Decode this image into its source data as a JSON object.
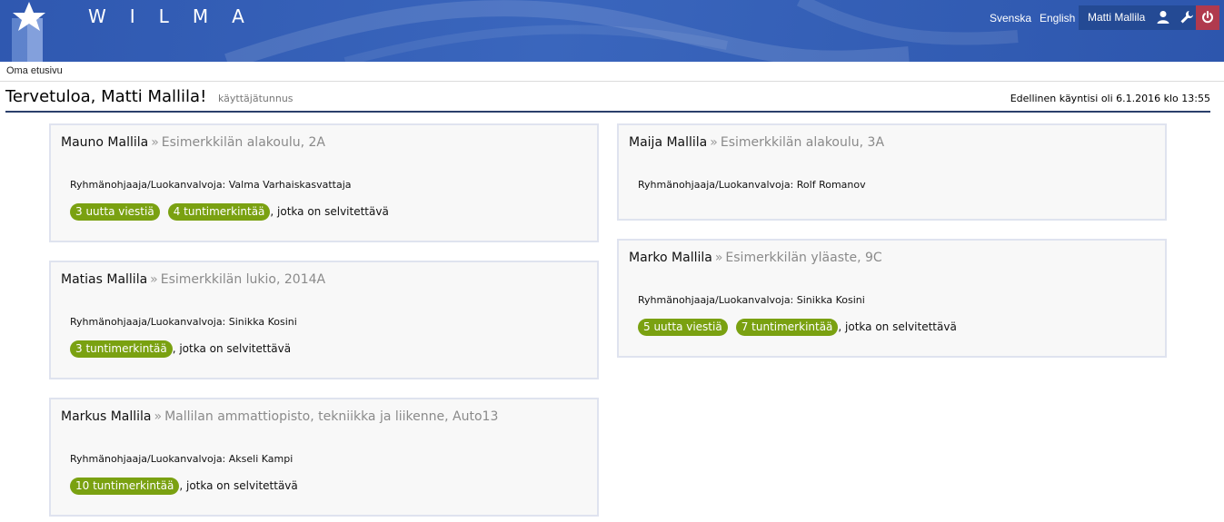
{
  "header": {
    "logo_text": "WILMA",
    "lang_sv": "Svenska",
    "lang_en": "English",
    "user_name": "Matti Mallila",
    "icons": [
      "star-logo-icon",
      "user-icon",
      "wrench-icon",
      "power-icon"
    ],
    "colors": {
      "header_bg": "#3a66bd",
      "userbox_bg": "#244a94",
      "power_bg": "#b03a4e"
    }
  },
  "breadcrumb": "Oma etusivu",
  "title": {
    "welcome": "Tervetuloa, Matti Mallila!",
    "username_label": "käyttäjätunnus",
    "last_visit": "Edellinen käyntisi oli 6.1.2016 klo 13:55"
  },
  "cards": [
    {
      "student": "Mauno Mallila",
      "separator": "»",
      "school": "Esimerkkilän alakoulu, 2A",
      "teacher": "Ryhmänohjaaja/Luokanvalvoja: Valma Varhaiskasvattaja",
      "badges": [
        "3 uutta viestiä",
        "4 tuntimerkintää"
      ],
      "trail": ", jotka on selvitettävä"
    },
    {
      "student": "Matias Mallila",
      "separator": "»",
      "school": "Esimerkkilän lukio, 2014A",
      "teacher": "Ryhmänohjaaja/Luokanvalvoja: Sinikka Kosini",
      "badges": [
        "3 tuntimerkintää"
      ],
      "trail": ", jotka on selvitettävä"
    },
    {
      "student": "Markus Mallila",
      "separator": "»",
      "school": "Mallilan ammattiopisto, tekniikka ja liikenne, Auto13",
      "teacher": "Ryhmänohjaaja/Luokanvalvoja: Akseli Kampi",
      "badges": [
        "10 tuntimerkintää"
      ],
      "trail": ", jotka on selvitettävä"
    },
    {
      "student": "Maija Mallila",
      "separator": "»",
      "school": "Esimerkkilän alakoulu, 3A",
      "teacher": "Ryhmänohjaaja/Luokanvalvoja: Rolf Romanov",
      "badges": [],
      "trail": ""
    },
    {
      "student": "Marko Mallila",
      "separator": "»",
      "school": "Esimerkkilän yläaste, 9C",
      "teacher": "Ryhmänohjaaja/Luokanvalvoja: Sinikka Kosini",
      "badges": [
        "5 uutta viestiä",
        "7 tuntimerkintää"
      ],
      "trail": ", jotka on selvitettävä"
    }
  ],
  "badge_color": "#7aa111"
}
